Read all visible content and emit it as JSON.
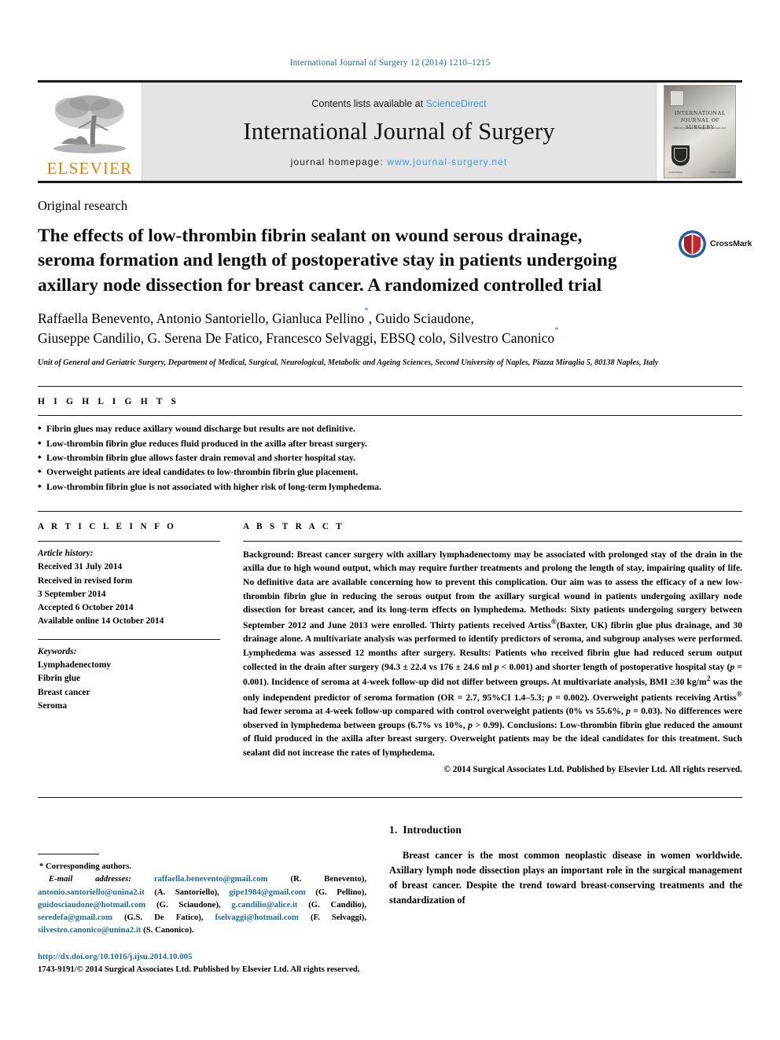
{
  "running_head": "International Journal of Surgery 12 (2014) 1210–1215",
  "masthead": {
    "contents_prefix": "Contents lists available at ",
    "sciencedirect": "ScienceDirect",
    "journal_name": "International Journal of Surgery",
    "homepage_prefix": "journal homepage: ",
    "homepage_url": "www.journal-surgery.net",
    "publisher_logo_text": "ELSEVIER",
    "cover": {
      "title": "INTERNATIONAL JOURNAL OF SURGERY",
      "subtitle": "Official journal of the Surgical Associates Ltd",
      "footer_right": "ISSN 1743-9191",
      "footer_left": "ScienceDirect"
    },
    "accent_link_color": "#3b9fd4",
    "elsevier_orange": "#ef7d00"
  },
  "article": {
    "type": "Original research",
    "title": "The effects of low-thrombin fibrin sealant on wound serous drainage, seroma formation and length of postoperative stay in patients undergoing axillary node dissection for breast cancer. A randomized controlled trial",
    "crossmark_label": "CrossMark",
    "authors_line1": "Raffaella Benevento, Antonio Santoriello, Gianluca Pellino",
    "authors_line1_cont": ", Guido Sciaudone,",
    "authors_line2": "Giuseppe Candilio, G. Serena De Fatico, Francesco Selvaggi, EBSQ colo, Silvestro Canonico",
    "author_marker": "*",
    "affiliation": "Unit of General and Geriatric Surgery, Department of Medical, Surgical, Neurological, Metabolic and Ageing Sciences, Second University of Naples, Piazza Miraglia 5, 80138 Naples, Italy"
  },
  "highlights": {
    "heading": "H I G H L I G H T S",
    "items": [
      "Fibrin glues may reduce axillary wound discharge but results are not definitive.",
      "Low-thrombin fibrin glue reduces fluid produced in the axilla after breast surgery.",
      "Low-thrombin fibrin glue allows faster drain removal and shorter hospital stay.",
      "Overweight patients are ideal candidates to low-thrombin fibrin glue placement.",
      "Low-thrombin fibrin glue is not associated with higher risk of long-term lymphedema."
    ]
  },
  "article_info": {
    "heading": "A R T I C L E  I N F O",
    "history_label": "Article history:",
    "history": [
      "Received 31 July 2014",
      "Received in revised form",
      "3 September 2014",
      "Accepted 6 October 2014",
      "Available online 14 October 2014"
    ],
    "keywords_label": "Keywords:",
    "keywords": [
      "Lymphadenectomy",
      "Fibrin glue",
      "Breast cancer",
      "Seroma"
    ]
  },
  "abstract": {
    "heading": "A B S T R A C T",
    "background_label": "Background:",
    "background_text": " Breast cancer surgery with axillary lymphadenectomy may be associated with prolonged stay of the drain in the axilla due to high wound output, which may require further treatments and prolong the length of stay, impairing quality of life. No definitive data are available concerning how to prevent this complication. Our aim was to assess the efficacy of a new low-thrombin fibrin glue in reducing the serous output from the axillary surgical wound in patients undergoing axillary node dissection for breast cancer, and its long-term effects on lymphedema. ",
    "methods_label": "Methods:",
    "methods_text_a": " Sixty patients undergoing surgery between September 2012 and June 2013 were enrolled. Thirty patients received Artiss",
    "methods_reg": "®",
    "methods_text_b": "(Baxter, UK) fibrin glue plus drainage, and 30 drainage alone. A multivariate analysis was performed to identify predictors of seroma, and subgroup analyses were performed. Lymphedema was assessed 12 months after surgery. ",
    "results_label": "Results:",
    "results_text_a": " Patients who received fibrin glue had reduced serum output collected in the drain after surgery (94.3 ± 22.4 vs 176 ± 24.6 ml ",
    "results_p1": "p",
    "results_text_b": " < 0.001) and shorter length of postoperative hospital stay (",
    "results_p2": "p",
    "results_text_c": " = 0.001). Incidence of seroma at 4-week follow-up did not differ between groups. At multivariate analysis, BMI ≥30 kg/m",
    "results_sup": "2",
    "results_text_d": " was the only independent predictor of seroma formation (OR = 2.7, 95%CI 1.4–5.3; ",
    "results_p3": "p",
    "results_text_e": " = 0.002). Overweight patients receiving Artiss",
    "results_reg": "®",
    "results_text_f": " had fewer seroma at 4-week follow-up compared with control overweight patients (0% vs 55.6%, ",
    "results_p4": "p",
    "results_text_g": " = 0.03). No differences were observed in lymphedema between groups (6.7% vs 10%, ",
    "results_p5": "p",
    "results_text_h": " > 0.99). ",
    "conclusions_label": "Conclusions:",
    "conclusions_text": " Low-thrombin fibrin glue reduced the amount of fluid produced in the axilla after breast surgery. Overweight patients may be the ideal candidates for this treatment. Such sealant did not increase the rates of lymphedema.",
    "copyright": "© 2014 Surgical Associates Ltd. Published by Elsevier Ltd. All rights reserved."
  },
  "footnotes": {
    "corresponding": "* Corresponding authors.",
    "email_label": "E-mail addresses:",
    "emails": [
      {
        "address": "raffaella.benevento@gmail.com",
        "person": "(R. Benevento)"
      },
      {
        "address": "antonio.santoriello@unina2.it",
        "person": "(A. Santoriello)"
      },
      {
        "address": "gipe1984@gmail.com",
        "person": "(G. Pellino)"
      },
      {
        "address": "guidosciaudone@hotmail.com",
        "person": "(G. Sciaudone)"
      },
      {
        "address": "g.candilio@alice.it",
        "person": "(G. Candilio)"
      },
      {
        "address": "seredefa@gmail.com",
        "person": "(G.S. De Fatico)"
      },
      {
        "address": "fselvaggi@hotmail.com",
        "person": "(F. Selvaggi)"
      },
      {
        "address": "silvestro.canonico@unina2.it",
        "person": "(S. Canonico)"
      }
    ],
    "doi": "http://dx.doi.org/10.1016/j.ijsu.2014.10.005",
    "issn_line": "1743-9191/© 2014 Surgical Associates Ltd. Published by Elsevier Ltd. All rights reserved."
  },
  "introduction": {
    "number": "1.",
    "heading": "Introduction",
    "paragraph": "Breast cancer is the most common neoplastic disease in women worldwide. Axillary lymph node dissection plays an important role in the surgical management of breast cancer. Despite the trend toward breast-conserving treatments and the standardization of"
  }
}
